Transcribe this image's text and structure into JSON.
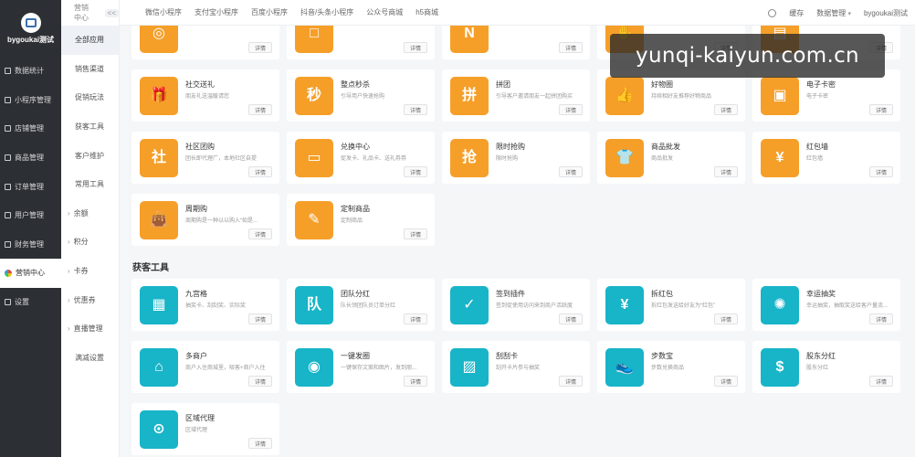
{
  "brand": {
    "name": "bygoukai测试"
  },
  "sidebar": {
    "items": [
      {
        "label": "数据统计"
      },
      {
        "label": "小程序管理"
      },
      {
        "label": "店铺管理"
      },
      {
        "label": "商品管理"
      },
      {
        "label": "订单管理"
      },
      {
        "label": "用户管理"
      },
      {
        "label": "财务管理"
      },
      {
        "label": "营销中心",
        "active": true
      },
      {
        "label": "设置"
      }
    ]
  },
  "subnav": {
    "title": "营销中心",
    "collapse": "<<",
    "items": [
      {
        "label": "全部应用",
        "active": true
      },
      {
        "label": "销售渠道"
      },
      {
        "label": "促销玩法"
      },
      {
        "label": "获客工具"
      },
      {
        "label": "客户维护"
      },
      {
        "label": "常用工具"
      },
      {
        "label": "余额",
        "expandable": true
      },
      {
        "label": "积分",
        "expandable": true
      },
      {
        "label": "卡券",
        "expandable": true
      },
      {
        "label": "优惠券",
        "expandable": true
      },
      {
        "label": "直播管理",
        "expandable": true
      },
      {
        "label": "满减设置"
      }
    ]
  },
  "topbar": {
    "tabs": [
      "微信小程序",
      "支付宝小程序",
      "百度小程序",
      "抖音/头条小程序",
      "公众号商城",
      "h5商城"
    ],
    "cache": "缓存",
    "data_mgmt": "数据管理",
    "username": "bygoukai测试"
  },
  "watermark": "yunqi-kaiyun.com.cn",
  "detail_label": "详情",
  "promo_cards": [
    {
      "title": "",
      "desc": "",
      "icon": "gift-icon",
      "glyph": "◎"
    },
    {
      "title": "",
      "desc": "",
      "icon": "box-icon",
      "glyph": "□"
    },
    {
      "title": "",
      "desc": "",
      "icon": "n-icon",
      "glyph": "N"
    },
    {
      "title": "",
      "desc": "",
      "icon": "hand-icon",
      "glyph": "✋"
    },
    {
      "title": "",
      "desc": "",
      "icon": "card-icon",
      "glyph": "▤"
    },
    {
      "title": "社交送礼",
      "desc": "朋友礼送温暖请您",
      "icon": "gift-icon",
      "glyph": "🎁"
    },
    {
      "title": "整点秒杀",
      "desc": "引导用户快速抢购",
      "icon": "miao-icon",
      "glyph": "秒"
    },
    {
      "title": "拼团",
      "desc": "引导客户邀请朋友一起拼团购买",
      "icon": "group-icon",
      "glyph": "拼"
    },
    {
      "title": "好物圈",
      "desc": "持续相好友推荐好物商品",
      "icon": "thumb-icon",
      "glyph": "👍"
    },
    {
      "title": "电子卡密",
      "desc": "电子卡密",
      "icon": "wallet-icon",
      "glyph": "▣"
    },
    {
      "title": "社区团购",
      "desc": "团长即代理广，本地社区自提",
      "icon": "community-icon",
      "glyph": "社"
    },
    {
      "title": "兑换中心",
      "desc": "促发卡、礼品卡、送礼券券",
      "icon": "ticket-icon",
      "glyph": "▭"
    },
    {
      "title": "限时抢购",
      "desc": "限时抢购",
      "icon": "clock-icon",
      "glyph": "抢"
    },
    {
      "title": "商品批发",
      "desc": "商品批发",
      "icon": "shirt-icon",
      "glyph": "👕"
    },
    {
      "title": "红包墙",
      "desc": "红包墙",
      "icon": "redpacket-icon",
      "glyph": "¥"
    },
    {
      "title": "周期购",
      "desc": "周期购是一种以以购入“如是...",
      "icon": "bag-icon",
      "glyph": "👜"
    },
    {
      "title": "定制商品",
      "desc": "定制商品",
      "icon": "ruler-icon",
      "glyph": "✎"
    }
  ],
  "acq_section_title": "获客工具",
  "acq_cards": [
    {
      "title": "九宫格",
      "desc": "抽奖卡、刮刮奖、实际奖",
      "icon": "grid-icon",
      "glyph": "▦"
    },
    {
      "title": "团队分红",
      "desc": "队长领团队员订单分红",
      "icon": "team-icon",
      "glyph": "队"
    },
    {
      "title": "签到插件",
      "desc": "签到促使用访问来到商户活跃度",
      "icon": "calendar-icon",
      "glyph": "✓"
    },
    {
      "title": "拆红包",
      "desc": "拆红包发送给好友为“红包”",
      "icon": "redpacket-icon",
      "glyph": "¥"
    },
    {
      "title": "幸运抽奖",
      "desc": "幸运抽奖，抽取奖送给客户量流...",
      "icon": "wheel-icon",
      "glyph": "✺"
    },
    {
      "title": "多商户",
      "desc": "商户入住商城里，吸客+商户入住",
      "icon": "shop-icon",
      "glyph": "⌂"
    },
    {
      "title": "一键发圈",
      "desc": "一键保存文案和图片，发到朋...",
      "icon": "aperture-icon",
      "glyph": "◉"
    },
    {
      "title": "刮刮卡",
      "desc": "刮开卡片参与抽奖",
      "icon": "scratch-icon",
      "glyph": "▨"
    },
    {
      "title": "步数宝",
      "desc": "步数兑换商品",
      "icon": "shoe-icon",
      "glyph": "👟"
    },
    {
      "title": "股东分红",
      "desc": "股东分红",
      "icon": "shareholder-icon",
      "glyph": "$"
    },
    {
      "title": "区域代理",
      "desc": "区域代理",
      "icon": "map-pin-icon",
      "glyph": "⊙"
    }
  ]
}
